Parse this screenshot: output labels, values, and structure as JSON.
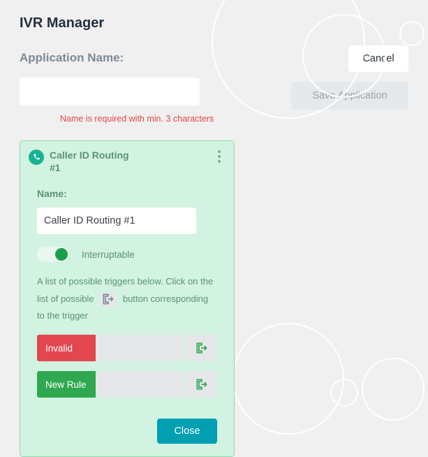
{
  "page": {
    "title": "IVR Manager"
  },
  "form": {
    "app_name_label": "Application Name:",
    "app_name_value": "",
    "error": "Name is required with min. 3 characters"
  },
  "actions": {
    "cancel": "Cancel",
    "save": "Save Application"
  },
  "card": {
    "title_line1": "Caller ID Routing",
    "title_line2": "#1",
    "name_label": "Name:",
    "name_value": "Caller ID Routing #1",
    "interruptable_label": "Interruptable",
    "interruptable_on": true,
    "help_part1": "A list of possible triggers below. Click on the list of possible",
    "help_part2": "button corresponding to the trigger",
    "rules": [
      {
        "label": "Invalid",
        "kind": "red"
      },
      {
        "label": "New Rule",
        "kind": "green"
      }
    ],
    "close": "Close"
  },
  "icons": {
    "phone": "phone-icon",
    "kebab": "kebab-icon",
    "exit": "exit-arrow-icon"
  }
}
